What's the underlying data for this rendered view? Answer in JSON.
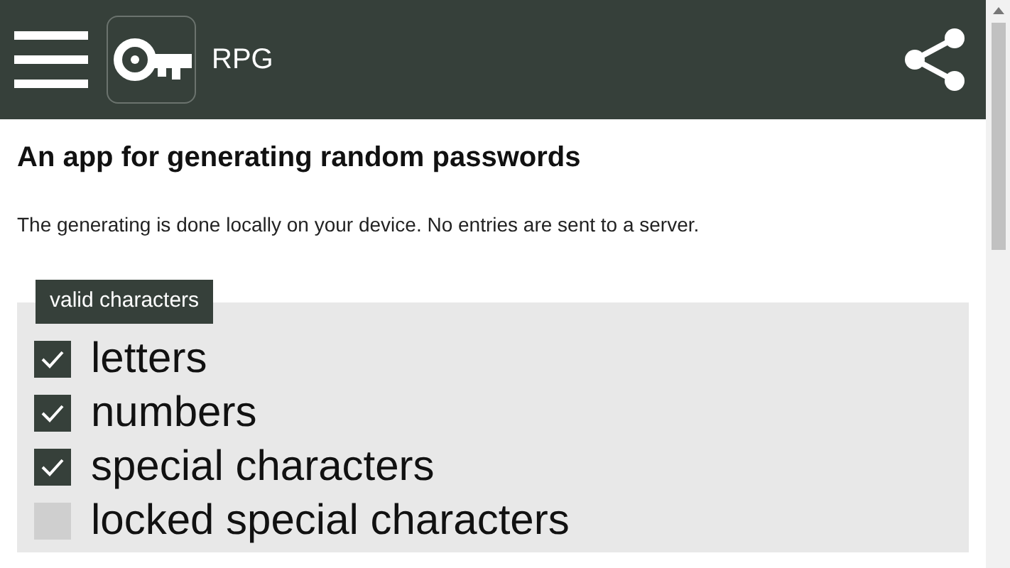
{
  "app_bar": {
    "title": "RPG"
  },
  "heading": "An app for generating random passwords",
  "description": "The generating is done locally on your device. No entries are sent to a server.",
  "fieldset": {
    "legend": "valid characters",
    "options": [
      {
        "label": "letters",
        "checked": true
      },
      {
        "label": "numbers",
        "checked": true
      },
      {
        "label": "special characters",
        "checked": true
      },
      {
        "label": "locked special characters",
        "checked": false
      }
    ]
  }
}
